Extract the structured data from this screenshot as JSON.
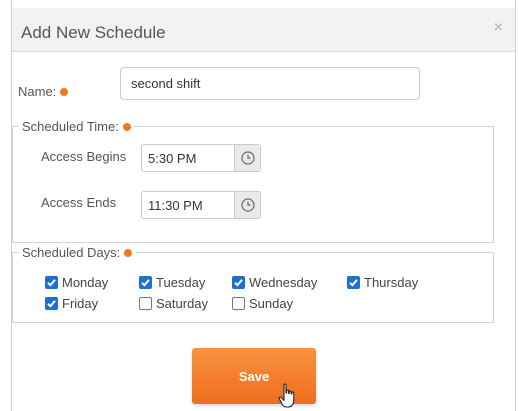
{
  "dialog": {
    "title": "Add New Schedule",
    "close_symbol": "×"
  },
  "form": {
    "name_label": "Name:",
    "name_value": "second shift",
    "scheduled_time_legend": "Scheduled Time:",
    "access_begins_label": "Access Begins",
    "access_begins_value": "5:30 PM",
    "access_ends_label": "Access Ends",
    "access_ends_value": "11:30 PM",
    "scheduled_days_legend": "Scheduled Days:",
    "days": [
      {
        "label": "Monday",
        "checked": true
      },
      {
        "label": "Tuesday",
        "checked": true
      },
      {
        "label": "Wednesday",
        "checked": true
      },
      {
        "label": "Thursday",
        "checked": true
      },
      {
        "label": "Friday",
        "checked": true
      },
      {
        "label": "Saturday",
        "checked": false
      },
      {
        "label": "Sunday",
        "checked": false
      }
    ],
    "save_label": "Save"
  },
  "colors": {
    "accent": "#f07a1a",
    "checkbox": "#1f6fd1"
  },
  "icons": {
    "required": "required-dot-icon",
    "clock": "clock-icon",
    "close": "close-icon",
    "cursor": "hand-pointer-icon",
    "check": "checkmark-icon"
  }
}
